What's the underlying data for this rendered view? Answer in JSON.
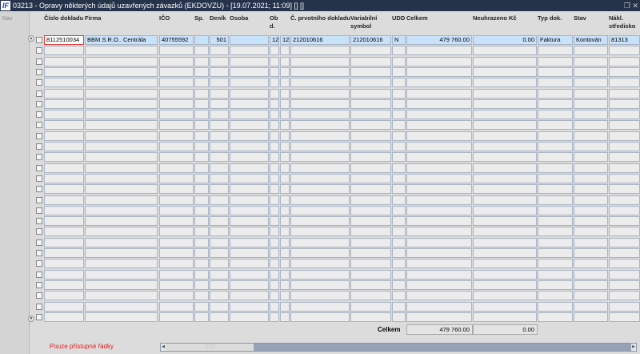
{
  "window": {
    "title": "03213 - Opravy některých údajů uzavřených závazků (EKDOVZU) - [19.07.2021; 11:09] [] []",
    "logo": "IF"
  },
  "nav": {
    "label": "Nav"
  },
  "columns": [
    {
      "key": "cislo",
      "label": "Číslo dokladu"
    },
    {
      "key": "firma",
      "label": "Firma"
    },
    {
      "key": "ico",
      "label": "IČO"
    },
    {
      "key": "sp",
      "label": "Sp."
    },
    {
      "key": "denik",
      "label": "Deník"
    },
    {
      "key": "osoba",
      "label": "Osoba"
    },
    {
      "key": "obd",
      "label": "Ob d."
    },
    {
      "key": "obd2",
      "label": ""
    },
    {
      "key": "prv",
      "label": "Č. prvotního dokladu"
    },
    {
      "key": "vs",
      "label": "Variabilní symbol"
    },
    {
      "key": "udd",
      "label": "UDD"
    },
    {
      "key": "celkem",
      "label": "Celkem"
    },
    {
      "key": "neuhr",
      "label": "Neuhrazeno Kč"
    },
    {
      "key": "typ",
      "label": "Typ dok."
    },
    {
      "key": "stav",
      "label": "Stav"
    },
    {
      "key": "nakl",
      "label": "Nákl. středisko"
    }
  ],
  "rows": [
    [
      "8112510034",
      "BBM S.R.O.. Centrála",
      "40755592",
      "",
      "501",
      "",
      "12",
      "12",
      "212010616",
      "212010616",
      "N",
      "479 760.00",
      "0.00",
      "Faktura",
      "Kontován",
      "81313"
    ]
  ],
  "totals": {
    "label": "Celkem",
    "celkem": "479 760.00",
    "neuhrazeno": "0.00"
  },
  "status": "Pouze přístupné řádky",
  "colors": {
    "titlebar": "#24324a",
    "selected_row": "#c9e2fb",
    "status_text": "#e02020"
  }
}
